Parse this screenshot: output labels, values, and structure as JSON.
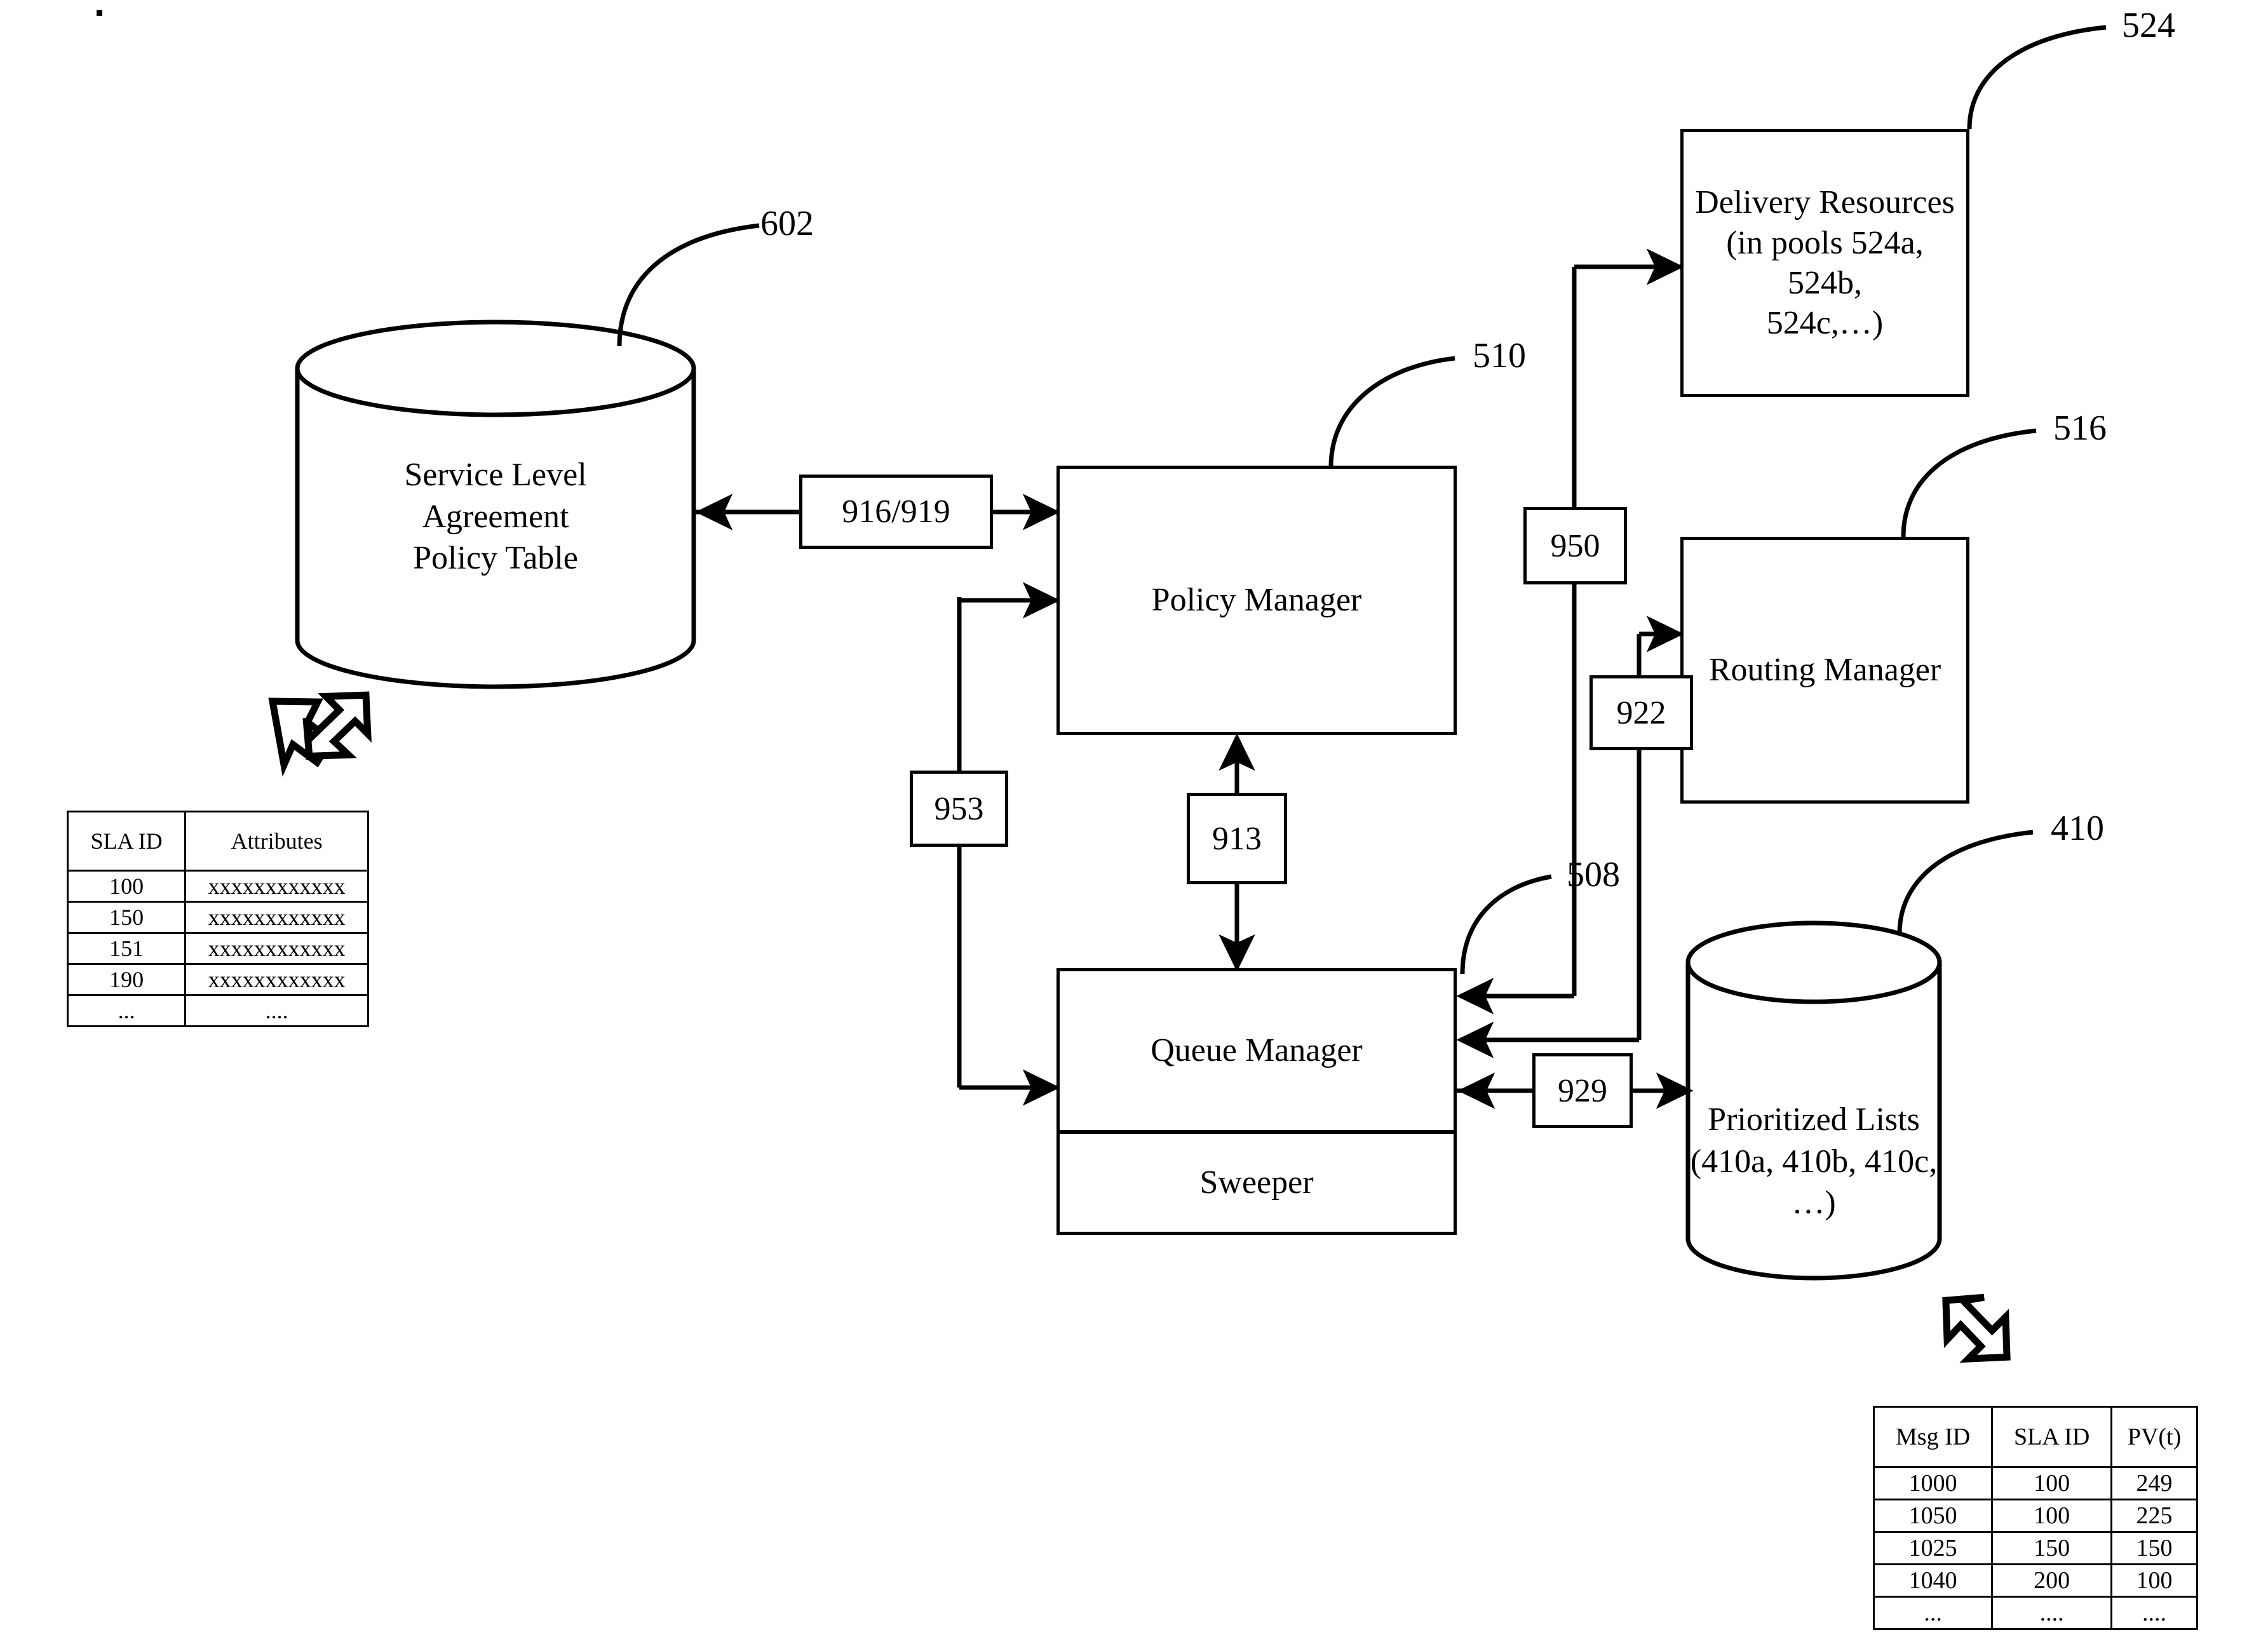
{
  "figure": {
    "type": "patent-block-diagram",
    "background": "#ffffff",
    "stroke": "#000000"
  },
  "nodes": {
    "sla_policy_table": {
      "shape": "cylinder",
      "label_line1": "Service Level",
      "label_line2": "Agreement",
      "label_line3": "Policy Table",
      "ref": "602"
    },
    "policy_manager": {
      "shape": "rect",
      "label": "Policy Manager",
      "ref": "510"
    },
    "queue_manager": {
      "shape": "rect",
      "label": "Queue Manager",
      "ref": "508"
    },
    "sweeper": {
      "shape": "rect",
      "label": "Sweeper"
    },
    "delivery_resources": {
      "shape": "rect",
      "label_line1": "Delivery Resources",
      "label_line2": "(in pools 524a, 524b,",
      "label_line3": "524c,…)",
      "ref": "524"
    },
    "routing_manager": {
      "shape": "rect",
      "label": "Routing Manager",
      "ref": "516"
    },
    "prioritized_lists": {
      "shape": "cylinder",
      "label_line1": "Prioritized Lists",
      "label_line2": "(410a, 410b, 410c, …)",
      "ref": "410"
    }
  },
  "connector_labels": {
    "sla_to_policy": "916/919",
    "policy_feedback": "953",
    "policy_queue": "913",
    "delivery_queue": "950",
    "routing_queue": "922",
    "queue_lists": "929"
  },
  "sla_table": {
    "headers": [
      "SLA ID",
      "Attributes"
    ],
    "rows": [
      [
        "100",
        "xxxxxxxxxxxx"
      ],
      [
        "150",
        "xxxxxxxxxxxx"
      ],
      [
        "151",
        "xxxxxxxxxxxx"
      ],
      [
        "190",
        "xxxxxxxxxxxx"
      ],
      [
        "...",
        "...."
      ]
    ]
  },
  "priority_table": {
    "headers": [
      "Msg ID",
      "SLA ID",
      "PV(t)"
    ],
    "rows": [
      [
        "1000",
        "100",
        "249"
      ],
      [
        "1050",
        "100",
        "225"
      ],
      [
        "1025",
        "150",
        "150"
      ],
      [
        "1040",
        "200",
        "100"
      ],
      [
        "...",
        "....",
        "...."
      ]
    ]
  },
  "icons": {
    "sla_expand_arrow": "double-headed-arrow-ne-sw",
    "priority_expand_arrow": "double-headed-arrow-nw-se"
  }
}
